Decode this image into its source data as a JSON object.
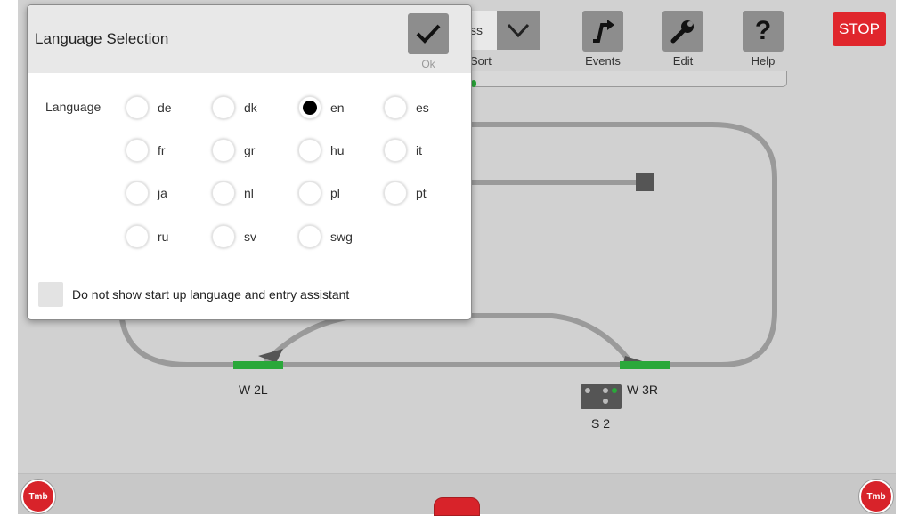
{
  "toolbar": {
    "class_value": "ss",
    "sort_label": "Sort",
    "events_label": "Events",
    "edit_label": "Edit",
    "help_label": "Help",
    "stop_label": "STOP"
  },
  "track": {
    "switch_left_label": "W 2L",
    "switch_right_label": "W 3R",
    "signal_label": "S 2",
    "track_color": "#9a9a9a",
    "switch_color": "#2aa83a"
  },
  "dialog": {
    "title": "Language Selection",
    "ok_label": "Ok",
    "language_label": "Language",
    "languages": [
      {
        "code": "de",
        "selected": false
      },
      {
        "code": "dk",
        "selected": false
      },
      {
        "code": "en",
        "selected": true
      },
      {
        "code": "es",
        "selected": false
      },
      {
        "code": "fr",
        "selected": false
      },
      {
        "code": "gr",
        "selected": false
      },
      {
        "code": "hu",
        "selected": false
      },
      {
        "code": "it",
        "selected": false
      },
      {
        "code": "ja",
        "selected": false
      },
      {
        "code": "nl",
        "selected": false
      },
      {
        "code": "pl",
        "selected": false
      },
      {
        "code": "pt",
        "selected": false
      },
      {
        "code": "ru",
        "selected": false
      },
      {
        "code": "sv",
        "selected": false
      },
      {
        "code": "swg",
        "selected": false
      }
    ],
    "no_show_text": "Do not show start up language and entry assistant",
    "no_show_checked": false
  },
  "colors": {
    "stop_red": "#e0262c",
    "button_gray": "#8d8d8d",
    "background_gray": "#d1d1d1"
  },
  "bottom": {
    "left_logo": "Tmb",
    "right_logo": "Tmb"
  }
}
